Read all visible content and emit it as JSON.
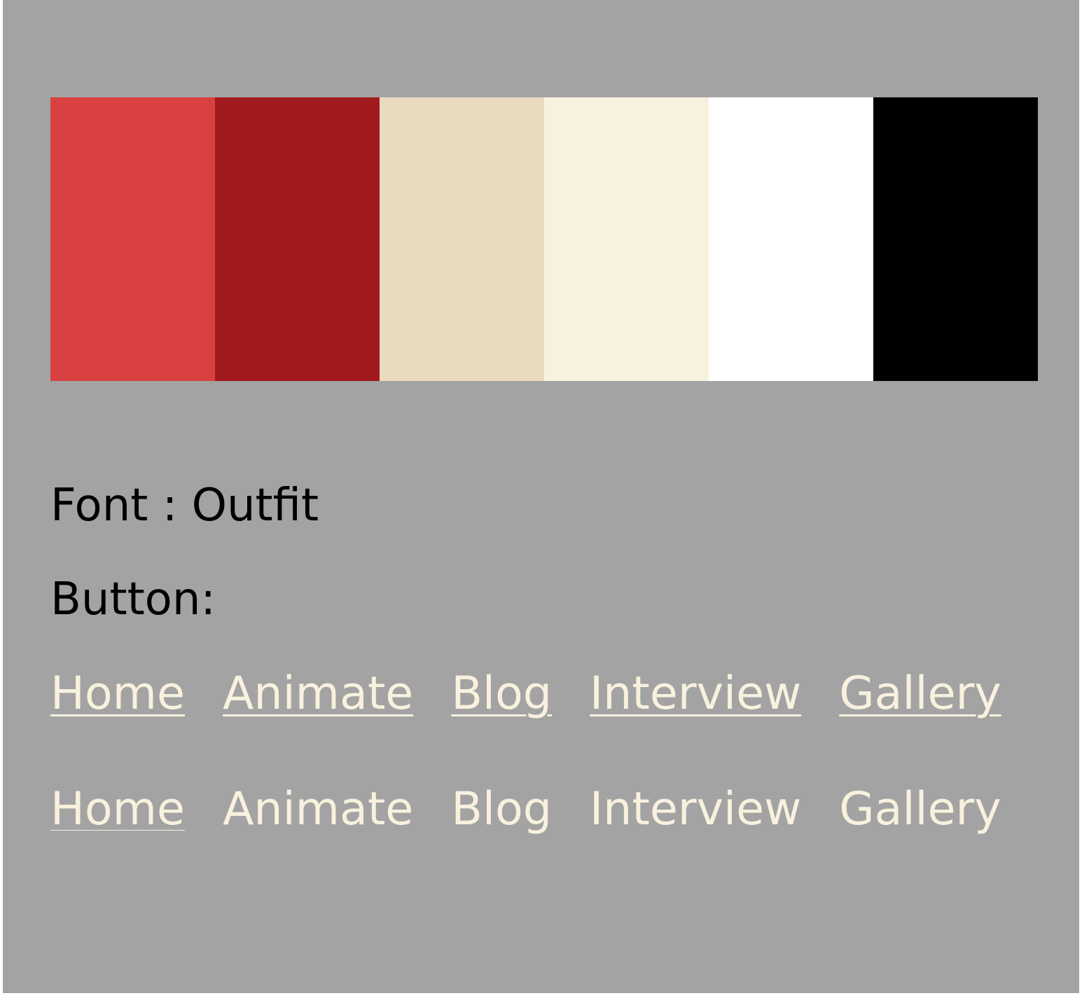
{
  "palette": {
    "colors": [
      "#d94141",
      "#a11a1e",
      "#e9dbbf",
      "#f8f1de",
      "#ffffff",
      "#000000"
    ]
  },
  "font_label": "Font : Outfit",
  "button_label": "Button:",
  "nav_underlined": [
    "Home",
    "Animate",
    "Blog",
    "Interview",
    "Gallery"
  ],
  "nav_plain": [
    "Home",
    "Animate",
    "Blog",
    "Interview",
    "Gallery"
  ],
  "link_color": "#f8f1de",
  "background_color": "#a3a3a3"
}
